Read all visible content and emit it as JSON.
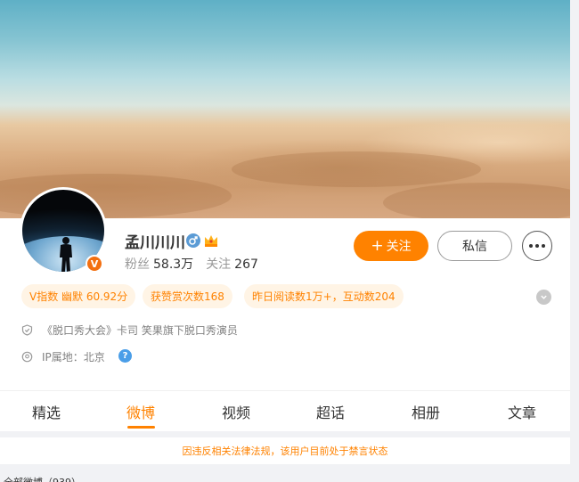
{
  "profile": {
    "name": "孟川川川",
    "fans_label": "粉丝",
    "fans_count": "58.3万",
    "following_label": "关注",
    "following_count": "267",
    "verified_badge": "V"
  },
  "actions": {
    "follow_label": "关注",
    "message_label": "私信"
  },
  "badges": [
    {
      "label": "V指数 幽默 60.92分"
    },
    {
      "label": "获赞赏次数168"
    },
    {
      "label": "昨日阅读数1万+，互动数204"
    }
  ],
  "info": {
    "bio": "《脱口秀大会》卡司 笑果旗下脱口秀演员",
    "ip_location": "IP属地：北京",
    "help_glyph": "?"
  },
  "tabs": [
    {
      "label": "精选"
    },
    {
      "label": "微博"
    },
    {
      "label": "视频"
    },
    {
      "label": "超话"
    },
    {
      "label": "相册"
    },
    {
      "label": "文章"
    }
  ],
  "active_tab": "微博",
  "notice": "因违反相关法律法规，该用户目前处于禁言状态",
  "feed_header_partial": "全部微博（939）",
  "colors": {
    "accent": "#ff8200",
    "badge_bg": "#fff4e5",
    "help_icon": "#4a9ee8",
    "gender_icon": "#5b9bd5"
  },
  "icons": [
    "gender-male-icon",
    "crown-icon",
    "more-dots-icon",
    "chevron-down-icon",
    "shield-icon",
    "location-icon",
    "help-icon"
  ]
}
